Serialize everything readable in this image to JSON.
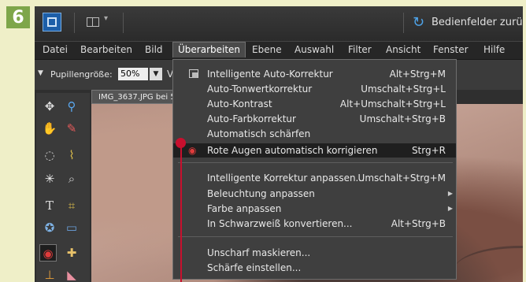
{
  "step": {
    "number": "6"
  },
  "topbar": {
    "panels_button": "Bedienfelder zurüc"
  },
  "menubar": {
    "items": [
      "Datei",
      "Bearbeiten",
      "Bild",
      "Überarbeiten",
      "Ebene",
      "Auswahl",
      "Filter",
      "Ansicht",
      "Fenster",
      "Hilfe"
    ],
    "active": "Überarbeiten"
  },
  "options": {
    "label": "Pupillengröße:",
    "value": "50%",
    "extra": "V"
  },
  "document": {
    "tab": "IMG_3637.JPG bei 5"
  },
  "menu": {
    "items": [
      {
        "label": "Intelligente Auto-Korrektur",
        "shortcut": "Alt+Strg+M",
        "icon": "auto-fix-icon"
      },
      {
        "label": "Auto-Tonwertkorrektur",
        "shortcut": "Umschalt+Strg+L"
      },
      {
        "label": "Auto-Kontrast",
        "shortcut": "Alt+Umschalt+Strg+L"
      },
      {
        "label": "Auto-Farbkorrektur",
        "shortcut": "Umschalt+Strg+B"
      },
      {
        "label": "Automatisch schärfen",
        "shortcut": ""
      },
      {
        "label": "Rote Augen automatisch korrigieren",
        "shortcut": "Strg+R",
        "icon": "red-eye-icon",
        "highlighted": true
      },
      {
        "label": "Intelligente Korrektur anpassen...",
        "shortcut": "Umschalt+Strg+M"
      },
      {
        "label": "Beleuchtung anpassen",
        "shortcut": "",
        "submenu": true
      },
      {
        "label": "Farbe anpassen",
        "shortcut": "",
        "submenu": true
      },
      {
        "label": "In Schwarzweiß konvertieren...",
        "shortcut": "Alt+Strg+B"
      },
      {
        "label": "Unscharf maskieren...",
        "shortcut": ""
      },
      {
        "label": "Schärfe einstellen...",
        "shortcut": ""
      }
    ]
  },
  "colors": {
    "accent_badge": "#7ea64a",
    "callout": "#c8102e",
    "background": "#efefc8"
  }
}
